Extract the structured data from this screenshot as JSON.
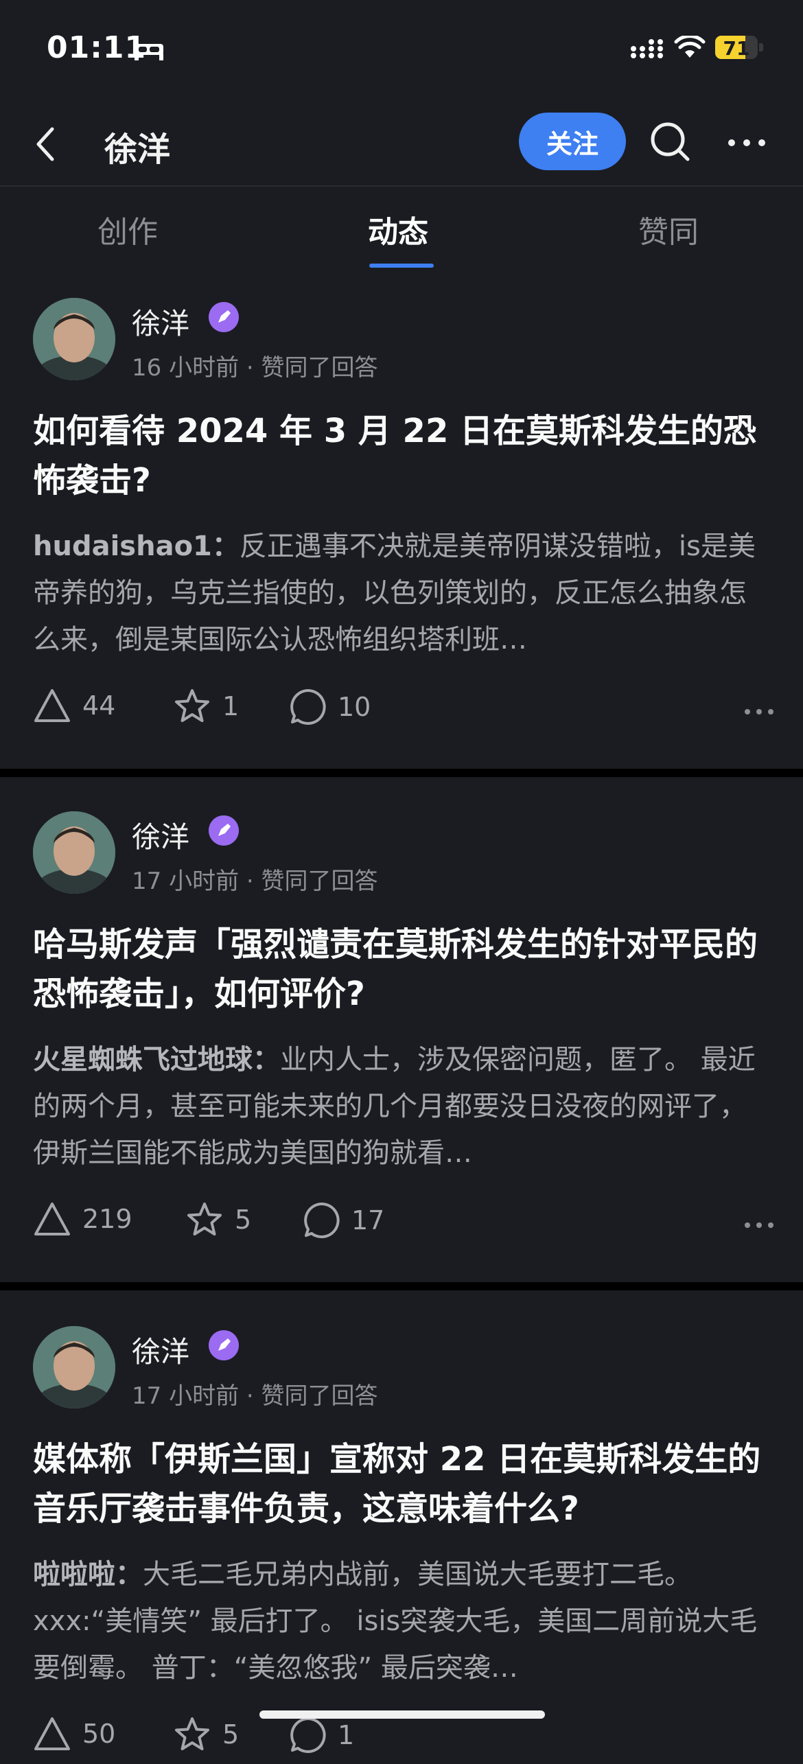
{
  "status": {
    "time": "01:11",
    "battery": "71",
    "battery_level": 0.71
  },
  "nav": {
    "title": "徐洋",
    "follow": "关注"
  },
  "tabs": [
    {
      "label": "创作",
      "active": false
    },
    {
      "label": "动态",
      "active": true
    },
    {
      "label": "赞同",
      "active": false
    }
  ],
  "feed": [
    {
      "author": "徐洋",
      "meta": "16 小时前 · 赞同了回答",
      "title": "如何看待 2024 年 3 月 22 日在莫斯科发生的恐怖袭击?",
      "excerpt_author": "hudaishao1：",
      "excerpt_text": "反正遇事不决就是美帝阴谋没错啦，is是美帝养的狗，乌克兰指使的，以色列策划的，反正怎么抽象怎么来，倒是某国际公认恐怖组织塔利班…",
      "likes": "44",
      "favorites": "1",
      "comments": "10"
    },
    {
      "author": "徐洋",
      "meta": "17 小时前 · 赞同了回答",
      "title": "哈马斯发声「强烈谴责在莫斯科发生的针对平民的恐怖袭击」，如何评价?",
      "excerpt_author": "火星蜘蛛飞过地球：",
      "excerpt_text": "业内人士，涉及保密问题，匿了。 最近的两个月，甚至可能未来的几个月都要没日没夜的网评了，伊斯兰国能不能成为美国的狗就看…",
      "likes": "219",
      "favorites": "5",
      "comments": "17"
    },
    {
      "author": "徐洋",
      "meta": "17 小时前 · 赞同了回答",
      "title": "媒体称「伊斯兰国」宣称对 22 日在莫斯科发生的音乐厅袭击事件负责，这意味着什么?",
      "excerpt_author": "啦啦啦：",
      "excerpt_text": "大毛二毛兄弟内战前，美国说大毛要打二毛。 xxx:“美情笑” 最后打了。 isis突袭大毛，美国二周前说大毛要倒霉。 普丁：“美忽悠我” 最后突袭…",
      "likes": "50",
      "favorites": "5",
      "comments": "1"
    }
  ]
}
